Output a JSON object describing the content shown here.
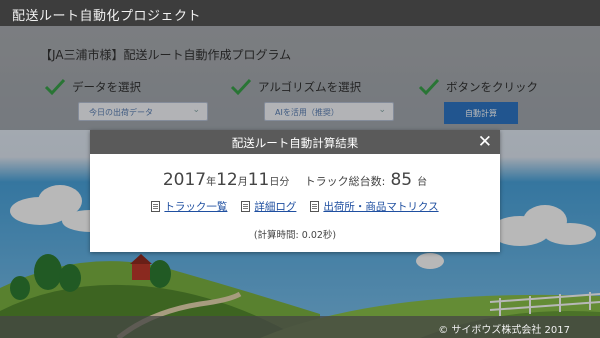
{
  "app": {
    "title": "配送ルート自動化プロジェクト"
  },
  "program": {
    "title": "【JA三浦市様】配送ルート自動作成プログラム"
  },
  "steps": [
    {
      "label": "データを選択",
      "control": "今日の出荷データ"
    },
    {
      "label": "アルゴリズムを選択",
      "control": "AIを活用（推奨）"
    },
    {
      "label": "ボタンをクリック",
      "control": "自動計算"
    }
  ],
  "modal": {
    "title": "配送ルート自動計算結果",
    "close": "✕",
    "date": {
      "year": "2017",
      "year_unit": "年",
      "month": "12",
      "month_unit": "月",
      "day": "11",
      "day_unit": "日分"
    },
    "truck_label": "トラック総台数:",
    "truck_count": "85",
    "truck_unit": "台",
    "links": [
      "トラック一覧",
      "詳細ログ",
      "出荷所・商品マトリクス"
    ],
    "calc_time": "(計算時間: 0.02秒)"
  },
  "footer": {
    "copyright": "© サイボウズ株式会社 2017"
  },
  "colors": {
    "titlebar": "#3d3d3d",
    "accent": "#2f77c7",
    "check": "#3aa34a",
    "link": "#1f4fa0",
    "modal_header": "#5a5a5a"
  }
}
